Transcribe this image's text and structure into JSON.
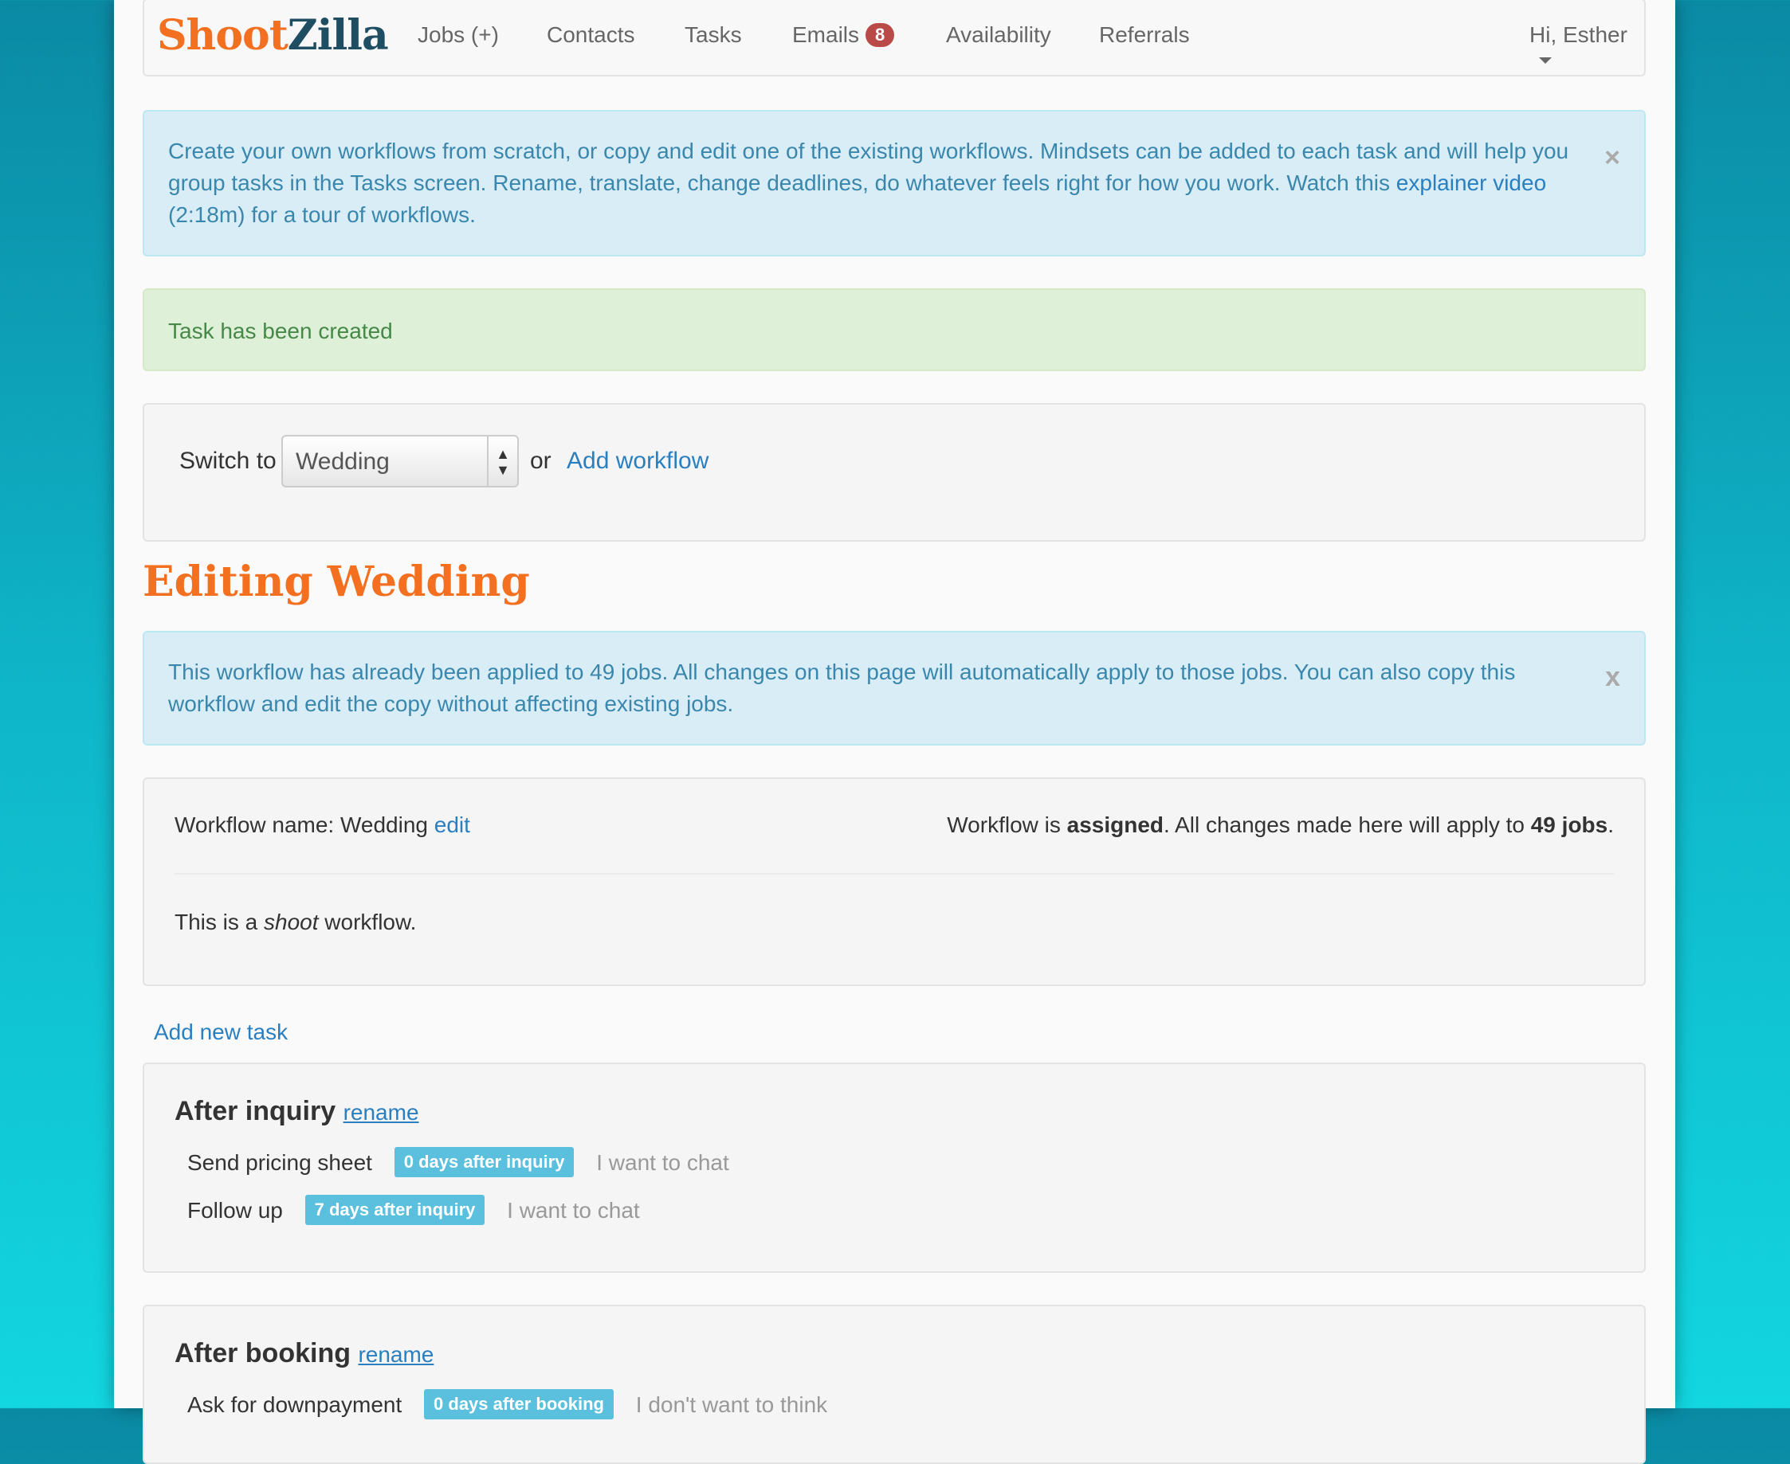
{
  "nav": {
    "brand_part1": "Shoot",
    "brand_part2": "Zilla",
    "items": [
      "Jobs (+)",
      "Contacts",
      "Tasks",
      "Emails",
      "Availability",
      "Referrals"
    ],
    "emails_count": "8",
    "user": "Hi, Esther"
  },
  "info_alert": {
    "text": "Create your own workflows from scratch, or copy and edit one of the existing workflows. Mindsets can be added to each task and will help you group tasks in the Tasks screen. Rename, translate, change deadlines, do whatever feels right for how you work. Watch this ",
    "link": "explainer video",
    "suffix": " (2:18m) for a tour of workflows.",
    "close": "×"
  },
  "success_alert": {
    "text": "Task has been created"
  },
  "switcher": {
    "label": "Switch to",
    "selected": "Wedding",
    "or": "or",
    "add_link": "Add workflow"
  },
  "editing_title": "Editing Wedding",
  "workflow_alert": {
    "text": "This workflow has already been applied to 49 jobs. All changes on this page will automatically apply to those jobs. You can also copy this workflow and edit the copy without affecting existing jobs.",
    "close": "x"
  },
  "workflow_info": {
    "name_label": "Workflow name: Wedding",
    "edit_link": "edit",
    "assigned_prefix": "Workflow is ",
    "assigned_word": "assigned",
    "assigned_middle": ". All changes made here will apply to ",
    "jobs_count": "49 jobs",
    "assigned_suffix": ".",
    "type_prefix": "This is a ",
    "type_word": "shoot",
    "type_suffix": " workflow."
  },
  "add_task_link": "Add new task",
  "groups": [
    {
      "title": "After inquiry",
      "rename": "rename",
      "tasks": [
        {
          "name": "Send pricing sheet",
          "deadline": "0 days after inquiry",
          "mindset": "I want to chat"
        },
        {
          "name": "Follow up",
          "deadline": "7 days after inquiry",
          "mindset": "I want to chat"
        }
      ]
    },
    {
      "title": "After booking",
      "rename": "rename",
      "tasks": [
        {
          "name": "Ask for downpayment",
          "deadline": "0 days after booking",
          "mindset": "I don't want to think"
        }
      ]
    }
  ]
}
